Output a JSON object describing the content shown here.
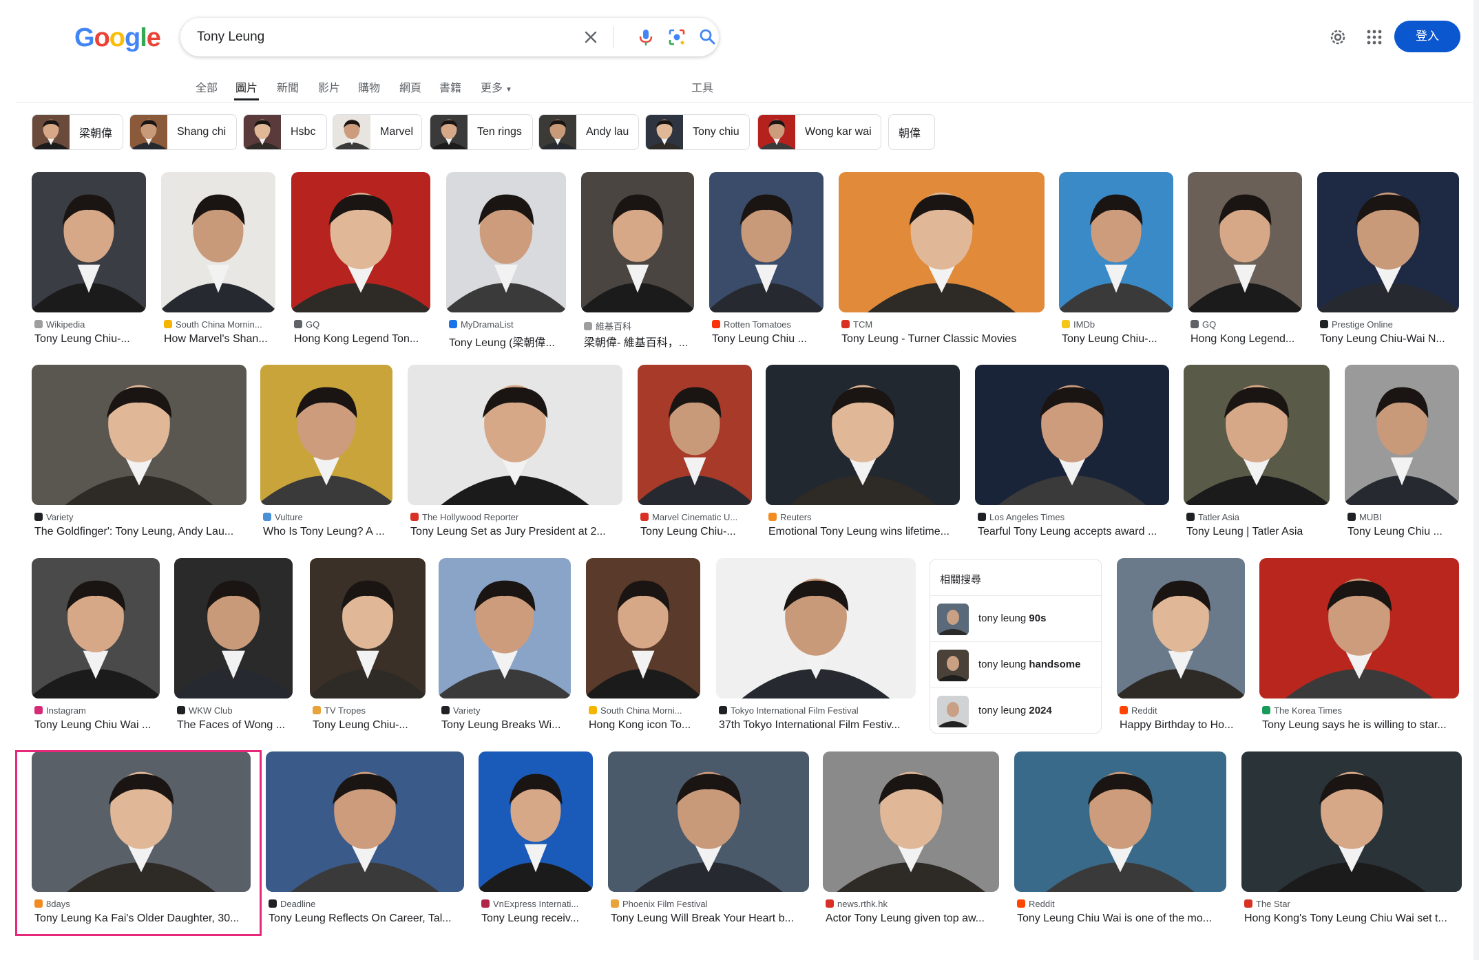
{
  "header": {
    "logo": [
      "G",
      "o",
      "o",
      "g",
      "l",
      "e"
    ],
    "logo_colors": [
      "#4285f4",
      "#ea4335",
      "#fbbc05",
      "#4285f4",
      "#34a853",
      "#ea4335"
    ],
    "search_value": "Tony Leung",
    "sign_in": "登入"
  },
  "tabs": [
    {
      "label": "全部"
    },
    {
      "label": "圖片"
    },
    {
      "label": "新聞"
    },
    {
      "label": "影片"
    },
    {
      "label": "購物"
    },
    {
      "label": "網頁"
    },
    {
      "label": "書籍"
    },
    {
      "label": "更多"
    }
  ],
  "tools_label": "工具",
  "chips": [
    {
      "label": "梁朝偉",
      "img": "#6a4a3a"
    },
    {
      "label": "Shang chi",
      "img": "#8a5a3a"
    },
    {
      "label": "Hsbc",
      "img": "#5a3a3a"
    },
    {
      "label": "Marvel",
      "img": "#e8e4df"
    },
    {
      "label": "Ten rings",
      "img": "#3a3a3a"
    },
    {
      "label": "Andy lau",
      "img": "#3c3a36"
    },
    {
      "label": "Tony chiu",
      "img": "#2e3440"
    },
    {
      "label": "Wong kar wai",
      "img": "#b5221e"
    },
    {
      "label": "朝偉",
      "img": ""
    }
  ],
  "rows": [
    [
      {
        "source": "Wikipedia",
        "title": "Tony Leung Chiu-...",
        "bg": "#3b3d44",
        "fav": "#9e9e9e"
      },
      {
        "source": "South China Mornin...",
        "title": "How Marvel's Shan...",
        "bg": "#e9e7e3",
        "fav": "#f4b400"
      },
      {
        "source": "GQ",
        "title": "Hong Kong Legend Ton...",
        "bg": "#b7241f",
        "fav": "#5f6368"
      },
      {
        "source": "MyDramaList",
        "title": "Tony Leung (梁朝偉...",
        "bg": "#d8dadd",
        "fav": "#1a73e8"
      },
      {
        "source": "維基百科",
        "title": "梁朝偉- 維基百科，...",
        "bg": "#4a4540",
        "fav": "#9e9e9e"
      },
      {
        "source": "Rotten Tomatoes",
        "title": "Tony Leung Chiu ...",
        "bg": "#3a4c6a",
        "fav": "#fa320a"
      },
      {
        "source": "TCM",
        "title": "Tony Leung - Turner Classic Movies",
        "bg": "#e08a3a",
        "fav": "#d93025"
      },
      {
        "source": "IMDb",
        "title": "Tony Leung Chiu-...",
        "bg": "#3a8ac8",
        "fav": "#f5c518"
      },
      {
        "source": "GQ",
        "title": "Hong Kong Legend...",
        "bg": "#6a6058",
        "fav": "#5f6368"
      },
      {
        "source": "Prestige Online",
        "title": "Tony Leung Chiu-Wai N...",
        "bg": "#1e2a44",
        "fav": "#202124"
      }
    ],
    [
      {
        "source": "Variety",
        "title": "The Goldfinger': Tony Leung, Andy Lau...",
        "bg": "#5a5650",
        "fav": "#202124"
      },
      {
        "source": "Vulture",
        "title": "Who Is Tony Leung? A ...",
        "bg": "#c8a43a",
        "fav": "#4a90d9"
      },
      {
        "source": "The Hollywood Reporter",
        "title": "Tony Leung Set as Jury President at 2...",
        "bg": "#e6e6e6",
        "fav": "#d93025"
      },
      {
        "source": "Marvel Cinematic U...",
        "title": "Tony Leung Chiu-...",
        "bg": "#a83a2a",
        "fav": "#d93025"
      },
      {
        "source": "Reuters",
        "title": "Emotional Tony Leung wins lifetime...",
        "bg": "#222830",
        "fav": "#f28b22"
      },
      {
        "source": "Los Angeles Times",
        "title": "Tearful Tony Leung accepts award ...",
        "bg": "#1a2438",
        "fav": "#202124"
      },
      {
        "source": "Tatler Asia",
        "title": "Tony Leung | Tatler Asia",
        "bg": "#5a5a48",
        "fav": "#202124"
      },
      {
        "source": "MUBI",
        "title": "Tony Leung Chiu ...",
        "bg": "#9a9a9a",
        "fav": "#202124"
      }
    ],
    [
      {
        "source": "Instagram",
        "title": "Tony Leung Chiu Wai ...",
        "bg": "#4a4a4a",
        "fav": "#d62976"
      },
      {
        "source": "WKW Club",
        "title": "The Faces of Wong ...",
        "bg": "#2a2a2a",
        "fav": "#202124"
      },
      {
        "source": "TV Tropes",
        "title": "Tony Leung Chiu-...",
        "bg": "#3a3028",
        "fav": "#e8a33a"
      },
      {
        "source": "Variety",
        "title": "Tony Leung Breaks Wi...",
        "bg": "#8aa4c8",
        "fav": "#202124"
      },
      {
        "source": "South China Morni...",
        "title": "Hong Kong icon To...",
        "bg": "#5a3a2a",
        "fav": "#f4b400"
      },
      {
        "source": "Tokyo International Film Festival",
        "title": "37th Tokyo International Film Festiv...",
        "bg": "#f0f0f0",
        "fav": "#202124"
      },
      {
        "source": "Reddit",
        "title": "Happy Birthday to Ho...",
        "bg": "#6a7a8a",
        "fav": "#ff4500"
      },
      {
        "source": "The Korea Times",
        "title": "Tony Leung says he is willing to star...",
        "bg": "#b8261e",
        "fav": "#1a9a5a"
      }
    ],
    [
      {
        "source": "8days",
        "title": "Tony Leung Ka Fai's Older Daughter, 30...",
        "bg": "#5a6068",
        "fav": "#f28b22"
      },
      {
        "source": "Deadline",
        "title": "Tony Leung Reflects On Career, Tal...",
        "bg": "#3a5a8a",
        "fav": "#202124"
      },
      {
        "source": "VnExpress Internati...",
        "title": "Tony Leung receiv...",
        "bg": "#1a5ab8",
        "fav": "#b0274a"
      },
      {
        "source": "Phoenix Film Festival",
        "title": "Tony Leung Will Break Your Heart b...",
        "bg": "#4a5a6a",
        "fav": "#e8a33a"
      },
      {
        "source": "news.rthk.hk",
        "title": "Actor Tony Leung given top aw...",
        "bg": "#8a8a8a",
        "fav": "#d93025"
      },
      {
        "source": "Reddit",
        "title": "Tony Leung Chiu Wai is one of the mo...",
        "bg": "#3a6a8a",
        "fav": "#ff4500"
      },
      {
        "source": "The Star",
        "title": "Hong Kong's Tony Leung Chiu Wai set t...",
        "bg": "#2a3438",
        "fav": "#d93025"
      }
    ]
  ],
  "related": {
    "heading": "相關搜尋",
    "items": [
      {
        "prefix": "tony leung ",
        "bold": "90s"
      },
      {
        "prefix": "tony leung ",
        "bold": "handsome"
      },
      {
        "prefix": "tony leung ",
        "bold": "2024"
      }
    ]
  },
  "icons": {
    "clear": "close-icon",
    "mic": "mic-icon",
    "lens": "camera-lens-icon",
    "search": "search-icon",
    "settings": "gear-icon",
    "apps": "apps-grid-icon"
  }
}
